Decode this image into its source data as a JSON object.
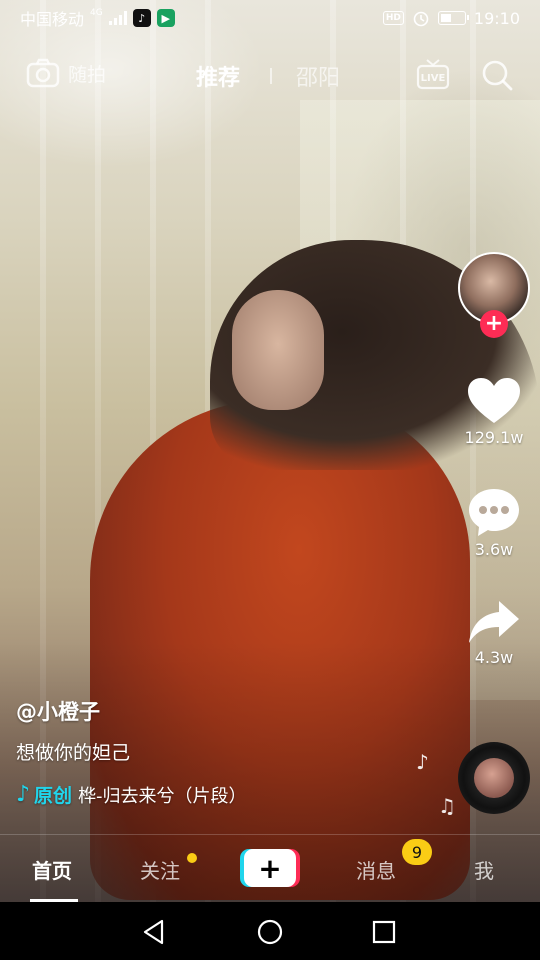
{
  "status_bar": {
    "carrier": "中国移动",
    "network": "4G",
    "hd": "HD",
    "time": "19:10",
    "battery_level": 0.45
  },
  "top_nav": {
    "camera_label": "随拍",
    "tab_recommend": "推荐",
    "tab_city": "邵阳",
    "live_label": "LIVE"
  },
  "actions": {
    "likes": "129.1w",
    "comments": "3.6w",
    "shares": "4.3w"
  },
  "caption": {
    "author": "@小橙子",
    "description": "想做你的妲己",
    "music_prefix": "原创",
    "music_title": "桦-归去来兮（片段）"
  },
  "tab_bar": {
    "home": "首页",
    "follow": "关注",
    "messages": "消息",
    "messages_badge": "9",
    "me": "我"
  },
  "colors": {
    "accent_red": "#fe2c55",
    "accent_cyan": "#20d5ec",
    "badge_yellow": "#facc15"
  }
}
